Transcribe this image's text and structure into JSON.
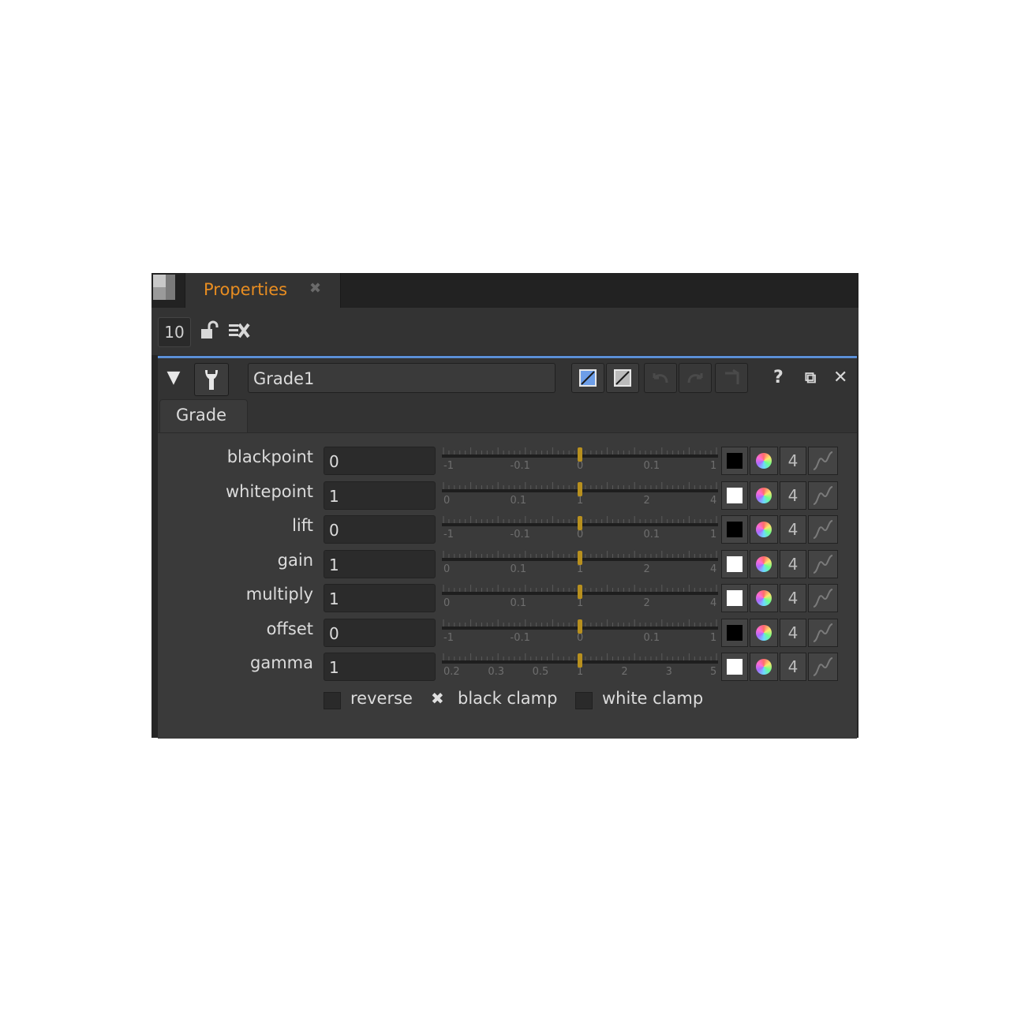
{
  "tab": {
    "label": "Properties",
    "close_glyph": "✖"
  },
  "toolbar": {
    "max_panels": "10",
    "icons": [
      "lock-icon",
      "clear-panels-icon"
    ]
  },
  "node": {
    "name": "Grade1",
    "collapse_glyph": "▼",
    "help_glyph": "?",
    "float_glyph": "⧉",
    "close_glyph": "✕",
    "icons": [
      "wrench-icon",
      "color-picker-icon",
      "value-picker-icon",
      "undo-icon",
      "redo-icon",
      "revert-icon",
      "help-icon",
      "float-icon",
      "close-icon"
    ]
  },
  "tabs": [
    {
      "label": "Grade"
    }
  ],
  "knobs": [
    {
      "label": "blackpoint",
      "value": "0",
      "swatch": "#000000",
      "ticks": [
        "-1",
        "-0.1",
        "0",
        "0.1",
        "1"
      ],
      "handle": 0.5,
      "channels": "4"
    },
    {
      "label": "whitepoint",
      "value": "1",
      "swatch": "#ffffff",
      "ticks": [
        "0",
        "0.1",
        "1",
        "2",
        "4"
      ],
      "handle": 0.5,
      "channels": "4"
    },
    {
      "label": "lift",
      "value": "0",
      "swatch": "#000000",
      "ticks": [
        "-1",
        "-0.1",
        "0",
        "0.1",
        "1"
      ],
      "handle": 0.5,
      "channels": "4"
    },
    {
      "label": "gain",
      "value": "1",
      "swatch": "#ffffff",
      "ticks": [
        "0",
        "0.1",
        "1",
        "2",
        "4"
      ],
      "handle": 0.5,
      "channels": "4"
    },
    {
      "label": "multiply",
      "value": "1",
      "swatch": "#ffffff",
      "ticks": [
        "0",
        "0.1",
        "1",
        "2",
        "4"
      ],
      "handle": 0.5,
      "channels": "4"
    },
    {
      "label": "offset",
      "value": "0",
      "swatch": "#000000",
      "ticks": [
        "-1",
        "-0.1",
        "0",
        "0.1",
        "1"
      ],
      "handle": 0.5,
      "channels": "4"
    },
    {
      "label": "gamma",
      "value": "1",
      "swatch": "#ffffff",
      "ticks": [
        "0.2",
        "0.3",
        "0.5",
        "1",
        "2",
        "3",
        "5"
      ],
      "handle": 0.5,
      "channels": "4"
    }
  ],
  "checkboxes": [
    {
      "label": "reverse",
      "checked": false
    },
    {
      "label": "black clamp",
      "checked": true,
      "glyph": "✖"
    },
    {
      "label": "white clamp",
      "checked": false
    }
  ],
  "colors": {
    "accent": "#e88d21",
    "selection": "#5b8fd6",
    "slider_handle": "#b8901e"
  }
}
